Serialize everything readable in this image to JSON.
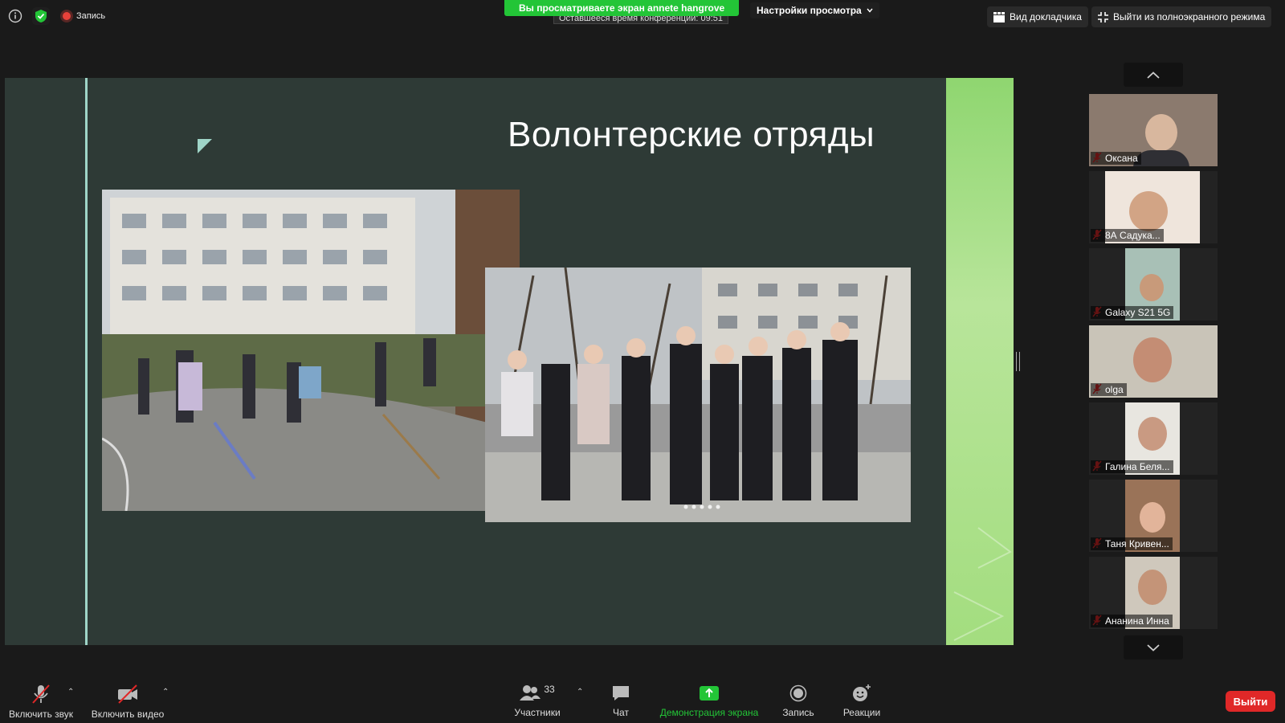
{
  "topbar": {
    "record_label": "Запись",
    "viewing_banner": "Вы просматриваете экран annete hangrove",
    "timer_text": "Оставшееся время конференции: 09:51",
    "view_options": "Настройки просмотра",
    "speaker_view": "Вид докладчика",
    "exit_fullscreen": "Выйти из полноэкранного режима"
  },
  "slide": {
    "title": "Волонтерские отряды"
  },
  "participants": [
    {
      "name": "Оксана"
    },
    {
      "name": "8А   Садука..."
    },
    {
      "name": "Galaxy S21 5G"
    },
    {
      "name": "olga"
    },
    {
      "name": "Галина   Беля..."
    },
    {
      "name": "Таня Кривен..."
    },
    {
      "name": "Ананина Инна"
    }
  ],
  "toolbar": {
    "audio": "Включить звук",
    "video": "Включить видео",
    "participants": "Участники",
    "participants_count": "33",
    "chat": "Чат",
    "share": "Демонстрация экрана",
    "record": "Запись",
    "reactions": "Реакции",
    "leave": "Выйти"
  },
  "colors": {
    "share_green": "#23c537",
    "leave_red": "#e02828",
    "slide_bg": "#2e3a36",
    "slide_accent": "#9fd5c8",
    "slide_stripe": "#a6e08a"
  }
}
